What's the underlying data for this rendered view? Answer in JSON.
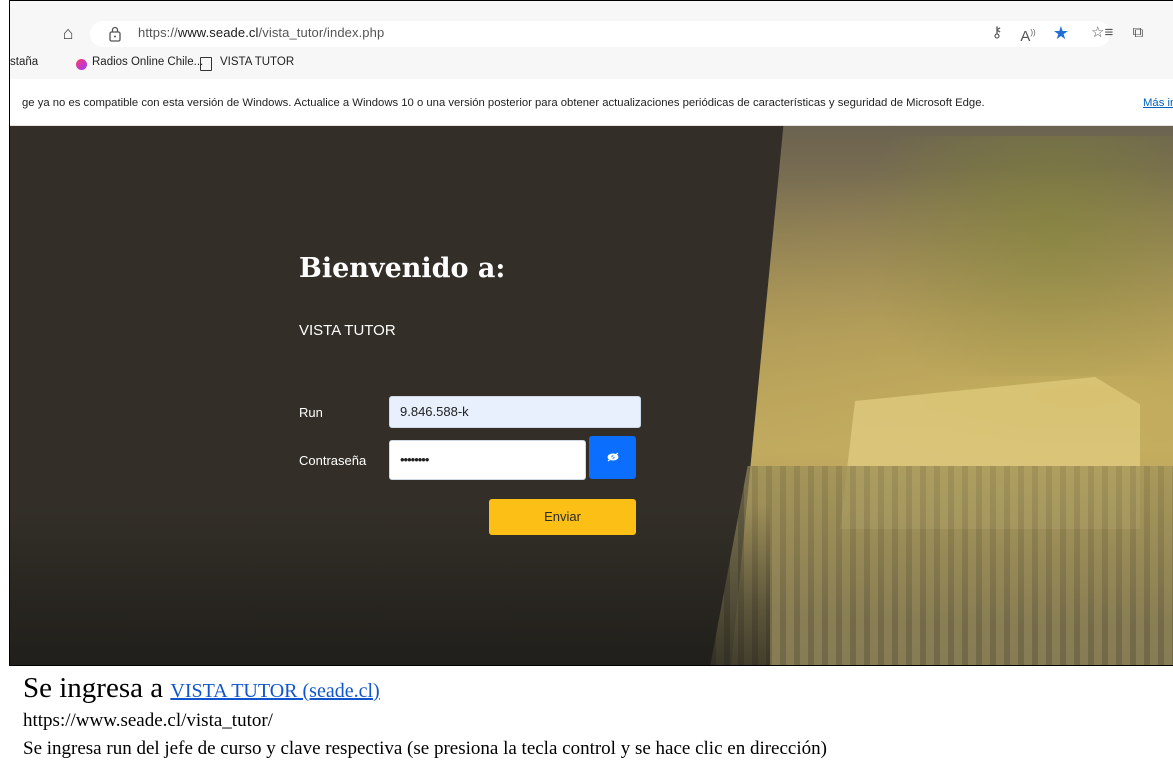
{
  "browser": {
    "url_prefix": "https://",
    "url_domain": "www.seade.cl",
    "url_path": "/vista_tutor/index.php",
    "icons": [
      "home-icon",
      "lock-icon",
      "key-icon",
      "read-aloud-icon",
      "favorite-star-icon",
      "favorites-list-icon",
      "collections-icon"
    ],
    "star_color": "#1f6fd6"
  },
  "favorites": {
    "item1": "staña",
    "item2": "Radios Online Chile...",
    "item3": "VISTA TUTOR"
  },
  "infobar": {
    "message": "ge ya no es compatible con esta versión de Windows. Actualice a Windows 10 o una versión posterior para obtener actualizaciones periódicas de características y seguridad de Microsoft Edge.",
    "link": "Más inf"
  },
  "login": {
    "title": "Bienvenido a:",
    "subtitle": "VISTA TUTOR",
    "run_label": "Run",
    "run_value": "9.846.588-k",
    "password_label": "Contraseña",
    "password_value": "••••••••",
    "eye_icon": "eye-icon",
    "submit_label": "Enviar",
    "submit_color": "#fbbf16",
    "eye_button_color": "#0b6efd"
  },
  "document": {
    "line1_prefix": "Se ingresa a ",
    "line1_link": "VISTA TUTOR (seade.cl)",
    "line2": "https://www.seade.cl/vista_tutor/",
    "line3": "Se ingresa run del jefe de curso y clave respectiva (se presiona la tecla control y se hace clic en dirección)"
  }
}
